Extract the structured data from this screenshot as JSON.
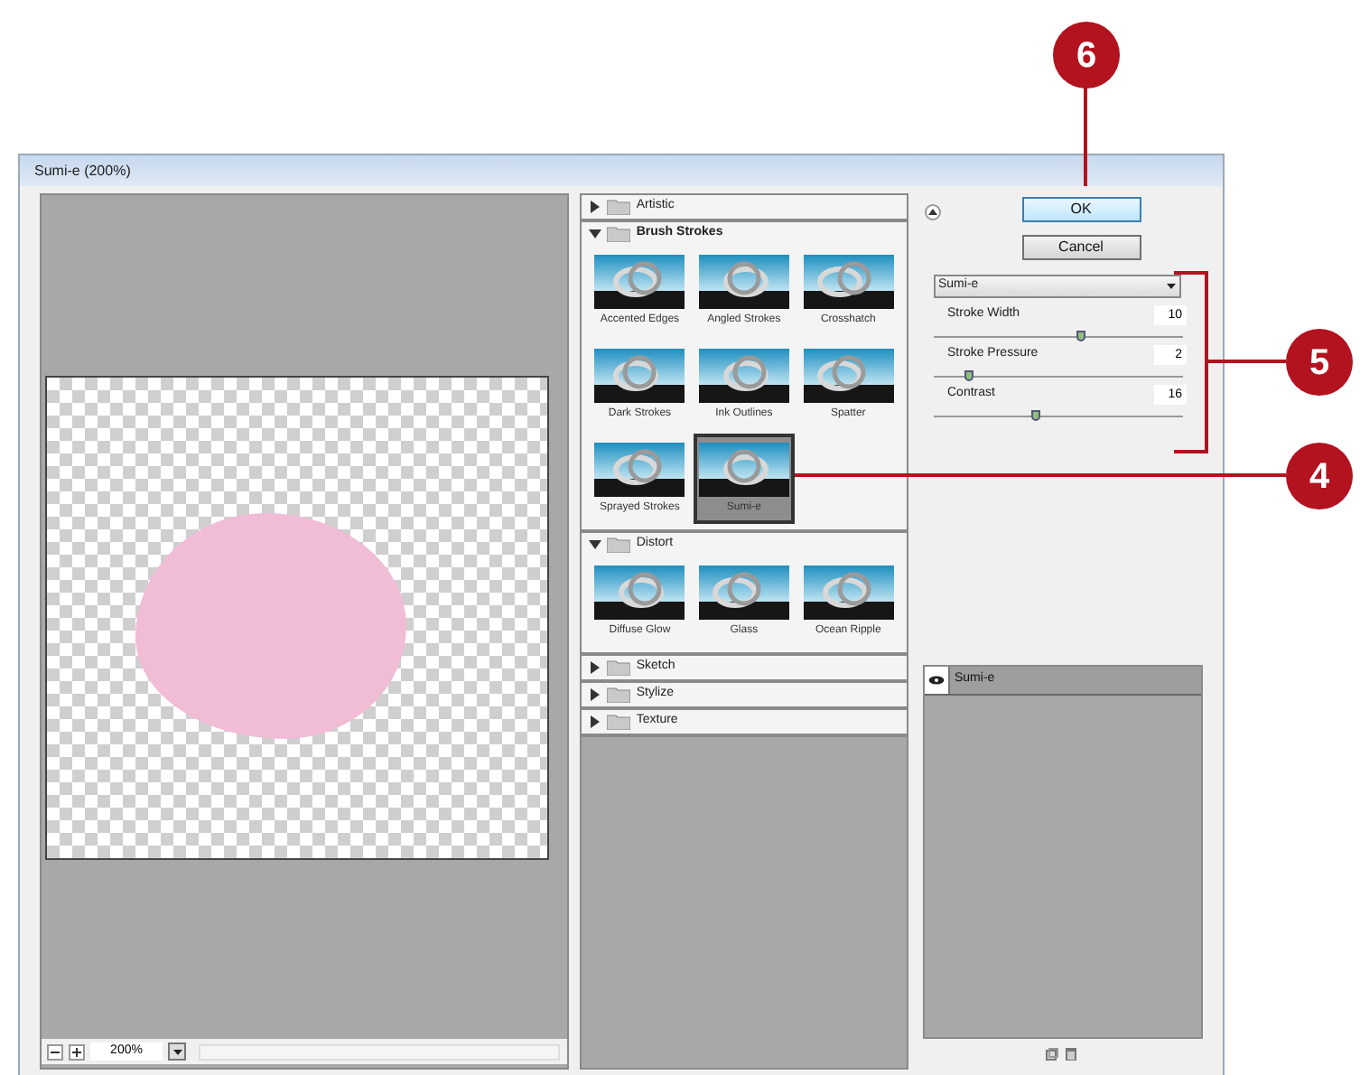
{
  "callouts": [
    {
      "label": "6"
    },
    {
      "label": "5"
    },
    {
      "label": "4"
    }
  ],
  "window": {
    "title": "Sumi-e (200%)"
  },
  "preview": {
    "zoom": "200%"
  },
  "gallery": {
    "categories": [
      {
        "name": "Artistic",
        "expanded": false
      },
      {
        "name": "Brush Strokes",
        "expanded": true,
        "filters": [
          {
            "name": "Accented Edges",
            "selected": false
          },
          {
            "name": "Angled Strokes",
            "selected": false
          },
          {
            "name": "Crosshatch",
            "selected": false
          },
          {
            "name": "Dark Strokes",
            "selected": false
          },
          {
            "name": "Ink Outlines",
            "selected": false
          },
          {
            "name": "Spatter",
            "selected": false
          },
          {
            "name": "Sprayed Strokes",
            "selected": false
          },
          {
            "name": "Sumi-e",
            "selected": true
          }
        ]
      },
      {
        "name": "Distort",
        "expanded": true,
        "filters": [
          {
            "name": "Diffuse Glow",
            "selected": false
          },
          {
            "name": "Glass",
            "selected": false
          },
          {
            "name": "Ocean Ripple",
            "selected": false
          }
        ]
      },
      {
        "name": "Sketch",
        "expanded": false
      },
      {
        "name": "Stylize",
        "expanded": false
      },
      {
        "name": "Texture",
        "expanded": false
      }
    ]
  },
  "settings": {
    "ok": "OK",
    "cancel": "Cancel",
    "filter": "Sumi-e",
    "params": [
      {
        "label": "Stroke Width",
        "value": "10",
        "level": 0.6
      },
      {
        "label": "Stroke Pressure",
        "value": "2",
        "level": 0.15
      },
      {
        "label": "Contrast",
        "value": "16",
        "level": 0.42
      }
    ]
  },
  "layers": [
    {
      "name": "Sumi-e",
      "visible": true
    }
  ]
}
